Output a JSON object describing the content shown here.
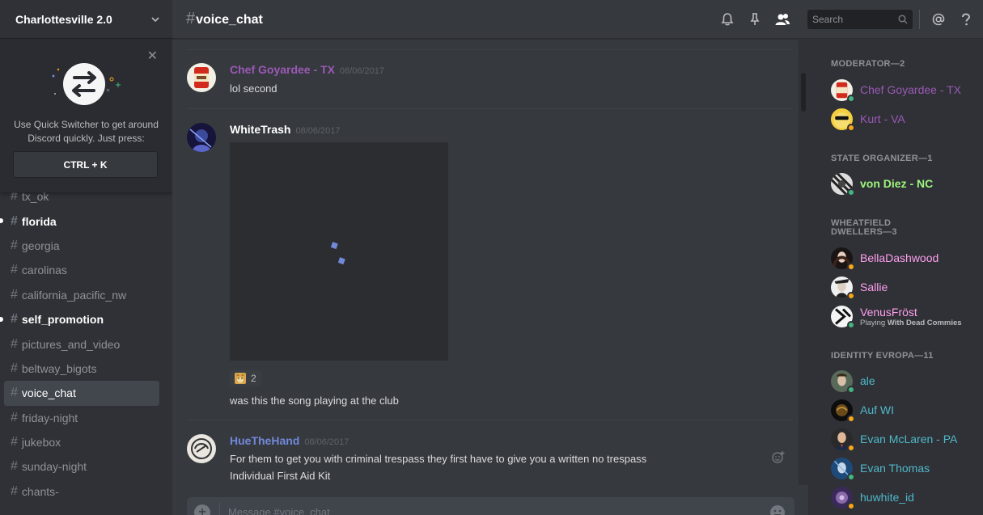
{
  "server": {
    "name": "Charlottesville 2.0"
  },
  "quick_switcher": {
    "text_line1": "Use Quick Switcher to get around",
    "text_line2": "Discord quickly. Just press:",
    "shortcut": "CTRL + K",
    "close_icon": "close-icon"
  },
  "channels": [
    {
      "name": "tx_ok",
      "unread": false,
      "active": false
    },
    {
      "name": "florida",
      "unread": true,
      "active": false
    },
    {
      "name": "georgia",
      "unread": false,
      "active": false
    },
    {
      "name": "carolinas",
      "unread": false,
      "active": false
    },
    {
      "name": "california_pacific_nw",
      "unread": false,
      "active": false
    },
    {
      "name": "self_promotion",
      "unread": true,
      "active": false
    },
    {
      "name": "pictures_and_video",
      "unread": false,
      "active": false
    },
    {
      "name": "beltway_bigots",
      "unread": false,
      "active": false
    },
    {
      "name": "voice_chat",
      "unread": false,
      "active": true
    },
    {
      "name": "friday-night",
      "unread": false,
      "active": false
    },
    {
      "name": "jukebox",
      "unread": false,
      "active": false
    },
    {
      "name": "sunday-night",
      "unread": false,
      "active": false
    },
    {
      "name": "chants-",
      "unread": false,
      "active": false
    }
  ],
  "header": {
    "channel": "voice_chat",
    "hash": "#",
    "search_placeholder": "Search",
    "icons": [
      "bell-icon",
      "pin-icon",
      "members-icon",
      "search-icon",
      "mention-icon",
      "help-icon"
    ]
  },
  "messages": [
    {
      "author": "Chef Goyardee - TX",
      "color": "#9b59b6",
      "timestamp": "08/06/2017",
      "lines": [
        "lol second"
      ]
    },
    {
      "author": "WhiteTrash",
      "color": "#ffffff",
      "timestamp": "08/06/2017",
      "lines": [
        "was this the song playing at the club"
      ],
      "reaction": {
        "emoji": "doge-emoji",
        "count": "2"
      }
    },
    {
      "author": "HueTheHand",
      "color": "#7289da",
      "timestamp": "08/06/2017",
      "lines": [
        "For them to get you with criminal trespass they first have to give you a written no trespass",
        "Individual First Aid Kit"
      ]
    }
  ],
  "composer": {
    "placeholder": "Message #voice_chat"
  },
  "member_groups": [
    {
      "title": "MODERATOR—2",
      "members": [
        {
          "name": "Chef Goyardee - TX",
          "color": "#9b59b6",
          "status": "online"
        },
        {
          "name": "Kurt - VA",
          "color": "#9b59b6",
          "status": "idle"
        }
      ]
    },
    {
      "title": "STATE ORGANIZER—1",
      "members": [
        {
          "name": "von Diez - NC",
          "color": "#9ff57e",
          "status": "online"
        }
      ]
    },
    {
      "title": "WHEATFIELD DWELLERS—3",
      "title_line1": "WHEATFIELD",
      "title_line2": "DWELLERS—3",
      "members": [
        {
          "name": "BellaDashwood",
          "color": "#ff9ff0",
          "status": "idle"
        },
        {
          "name": "Sallie",
          "color": "#ff9ff0",
          "status": "idle"
        },
        {
          "name": "VenusFröst",
          "color": "#ff9ff0",
          "status": "online",
          "game_prefix": "Playing",
          "game": "With Dead Commies"
        }
      ]
    },
    {
      "title": "IDENTITY EVROPA—11",
      "members": [
        {
          "name": "ale",
          "color": "#4fb8c9",
          "status": "online"
        },
        {
          "name": "Auf WI",
          "color": "#4fb8c9",
          "status": "idle"
        },
        {
          "name": "Evan McLaren - PA",
          "color": "#4fb8c9",
          "status": "idle"
        },
        {
          "name": "Evan Thomas",
          "color": "#4fb8c9",
          "status": "online"
        },
        {
          "name": "huwhite_id",
          "color": "#4fb8c9",
          "status": "idle"
        }
      ]
    }
  ],
  "status_colors": {
    "online": "#43b581",
    "idle": "#faa61a"
  }
}
